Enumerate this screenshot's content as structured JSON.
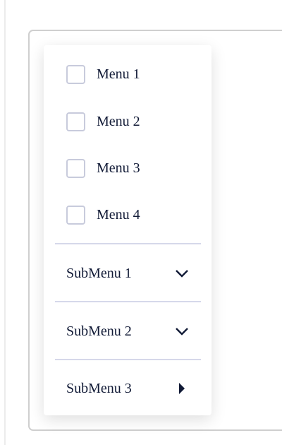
{
  "menu": {
    "checkbox_items": [
      {
        "label": "Menu 1",
        "checked": false
      },
      {
        "label": "Menu 2",
        "checked": false
      },
      {
        "label": "Menu 3",
        "checked": false
      },
      {
        "label": "Menu 4",
        "checked": false
      }
    ],
    "submenus": [
      {
        "label": "SubMenu 1",
        "icon": "chevron-down-icon"
      },
      {
        "label": "SubMenu 2",
        "icon": "chevron-down-icon"
      },
      {
        "label": "SubMenu 3",
        "icon": "caret-right-icon"
      }
    ]
  },
  "colors": {
    "text": "#111a36",
    "checkbox_border": "#c8cbdc",
    "divider": "#d6d8ea"
  }
}
